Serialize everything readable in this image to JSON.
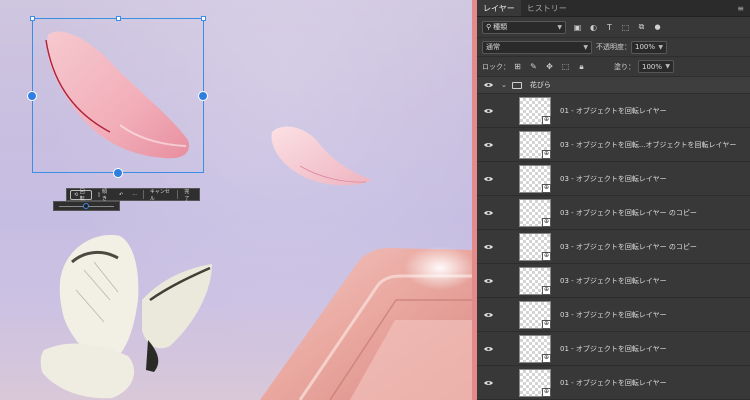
{
  "panel": {
    "tabs": [
      {
        "label": "レイヤー",
        "active": true
      },
      {
        "label": "ヒストリー",
        "active": false
      }
    ],
    "menu_icon": "≡",
    "filter": {
      "kind_label": "種類"
    },
    "blend": {
      "mode": "通常",
      "opacity_label": "不透明度：",
      "opacity": "100%"
    },
    "lock": {
      "label": "ロック：",
      "fill_label": "塗り：",
      "fill": "100%"
    },
    "group": {
      "name": "花びら"
    },
    "layers": [
      {
        "name": "01 - オブジェクトを回転レイヤー"
      },
      {
        "name": "03 - オブジェクトを回転...オブジェクトを回転レイヤー"
      },
      {
        "name": "03 - オブジェクトを回転レイヤー"
      },
      {
        "name": "03 - オブジェクトを回転レイヤー のコピー"
      },
      {
        "name": "03 - オブジェクトを回転レイヤー のコピー"
      },
      {
        "name": "03 - オブジェクトを回転レイヤー"
      },
      {
        "name": "03 - オブジェクトを回転レイヤー"
      },
      {
        "name": "01 - オブジェクトを回転レイヤー"
      },
      {
        "name": "01 - オブジェクトを回転レイヤー"
      }
    ]
  },
  "canvas": {
    "toolbar": {
      "rotate_label": "回転",
      "skew_label": "傾き",
      "more_label": "···",
      "cancel_label": "キャンセル",
      "done_label": "完了"
    }
  },
  "colors": {
    "accent": "#3b8de6",
    "divider": "#e58a8a",
    "panel_bg": "#383838"
  }
}
